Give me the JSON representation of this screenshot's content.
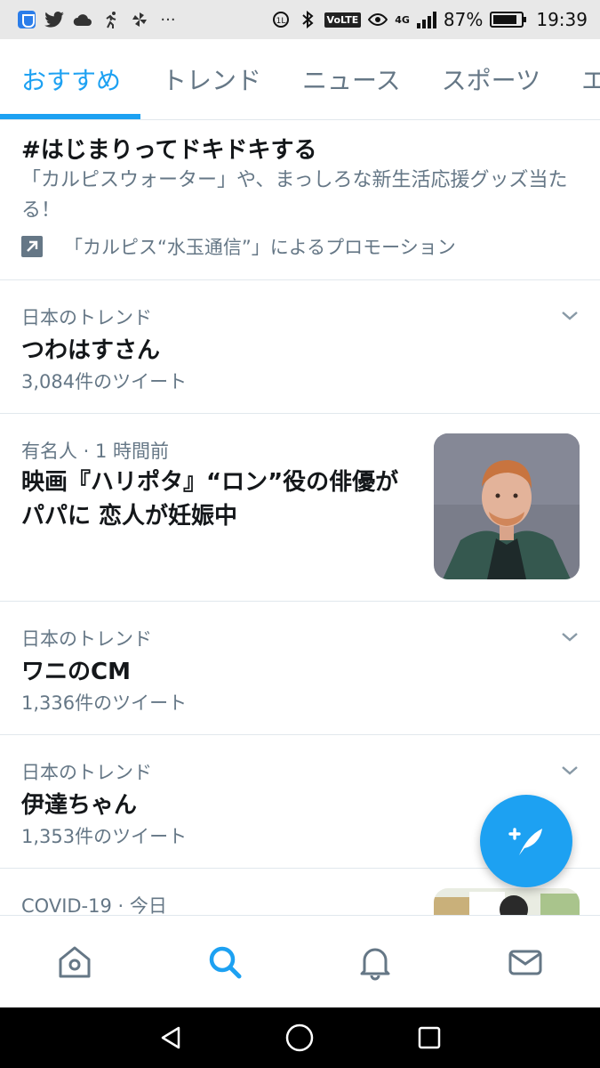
{
  "status": {
    "battery": "87%",
    "battery_fraction": 0.87,
    "time": "19:39",
    "network": "4G",
    "volte": "VoLTE",
    "left_icons": [
      "shield-icon",
      "twitter-icon",
      "cloud-icon",
      "runner-icon",
      "pinwheel-icon",
      "more-dots-icon"
    ]
  },
  "tabs": [
    {
      "label": "おすすめ",
      "active": true
    },
    {
      "label": "トレンド",
      "active": false
    },
    {
      "label": "ニュース",
      "active": false
    },
    {
      "label": "スポーツ",
      "active": false
    },
    {
      "label": "エ",
      "active": false
    }
  ],
  "promo": {
    "title": "#はじまりってドキドキする",
    "description": "「カルピスウォーター」や、まっしろな新生活応援グッズ当たる！",
    "promoted_by": "「カルピス“水玉通信”」によるプロモーション"
  },
  "trend1": {
    "meta": "日本のトレンド",
    "title": "つわはすさん",
    "count": "3,084件のツイート"
  },
  "news": {
    "meta": "有名人 · 1 時間前",
    "title": "映画『ハリポタ』“ロン”役の俳優がパパに 恋人が妊娠中"
  },
  "trend2": {
    "meta": "日本のトレンド",
    "title": "ワニのCM",
    "count": "1,336件のツイート"
  },
  "trend3": {
    "meta": "日本のトレンド",
    "title": "伊達ちゃん",
    "count": "1,353件のツイート"
  },
  "covid": {
    "meta": "COVID-19 · 今日"
  },
  "colors": {
    "accent": "#1da1f2",
    "secondary_text": "#657786",
    "divider": "#e1e8ed"
  }
}
